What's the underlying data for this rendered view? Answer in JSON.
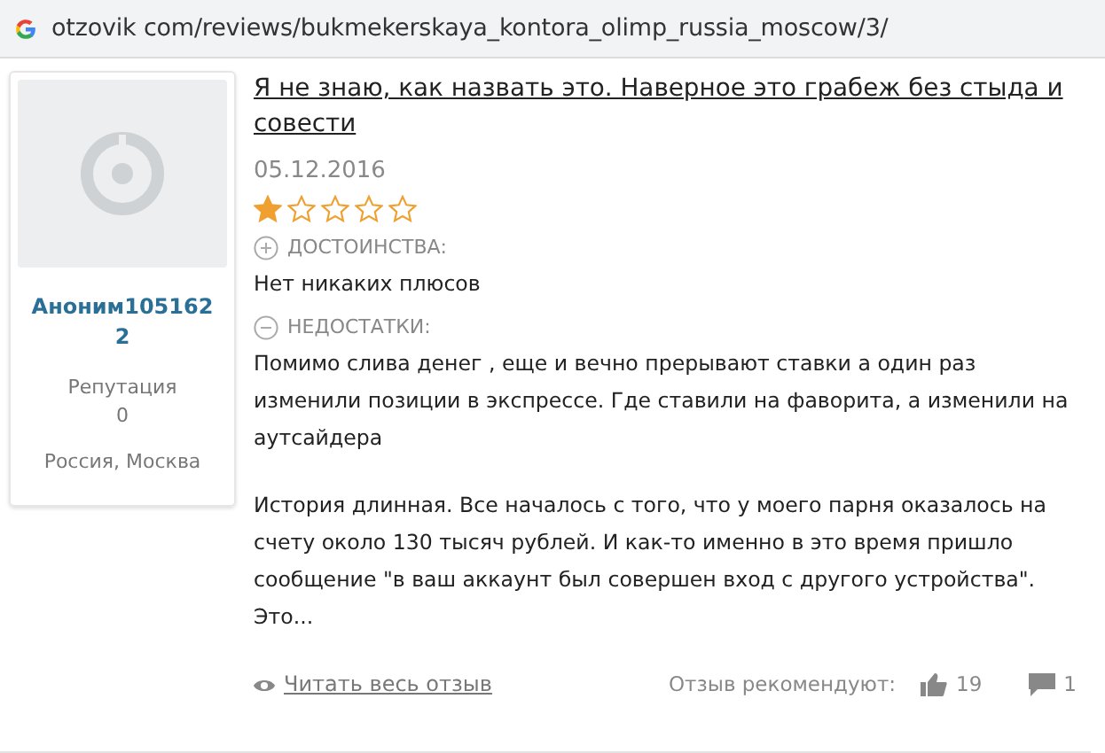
{
  "address_bar": {
    "url": "otzovik com/reviews/bukmekerskaya_kontora_olimp_russia_moscow/3/"
  },
  "author": {
    "name": "Аноним1051622",
    "reputation_label": "Репутация",
    "reputation": "0",
    "location": "Россия, Москва"
  },
  "review": {
    "title": "Я не знаю, как назвать это. Наверное это грабеж без стыда и совести",
    "date": "05.12.2016",
    "stars": 1,
    "sections": [
      {
        "kind": "plus",
        "label": "ДОСТОИНСТВА:",
        "text": "Нет никаких плюсов"
      },
      {
        "kind": "minus",
        "label": "НЕДОСТАТКИ:",
        "text": "Помимо слива денег , еще и вечно прерывают ставки а один раз изменили позиции в экспрессе. Где ставили на фаворита, а изменили на аутсайдера"
      }
    ],
    "excerpt": "История длинная. Все началось с того, что у моего парня оказалось на счету около 130 тысяч рублей. И как-то именно в это время пришло сообщение \"в ваш аккаунт был совершен вход с другого устройства\". Это...",
    "read_more": "Читать весь отзыв",
    "recommend_label": "Отзыв рекомендуют:",
    "likes": "19",
    "comments": "1"
  }
}
